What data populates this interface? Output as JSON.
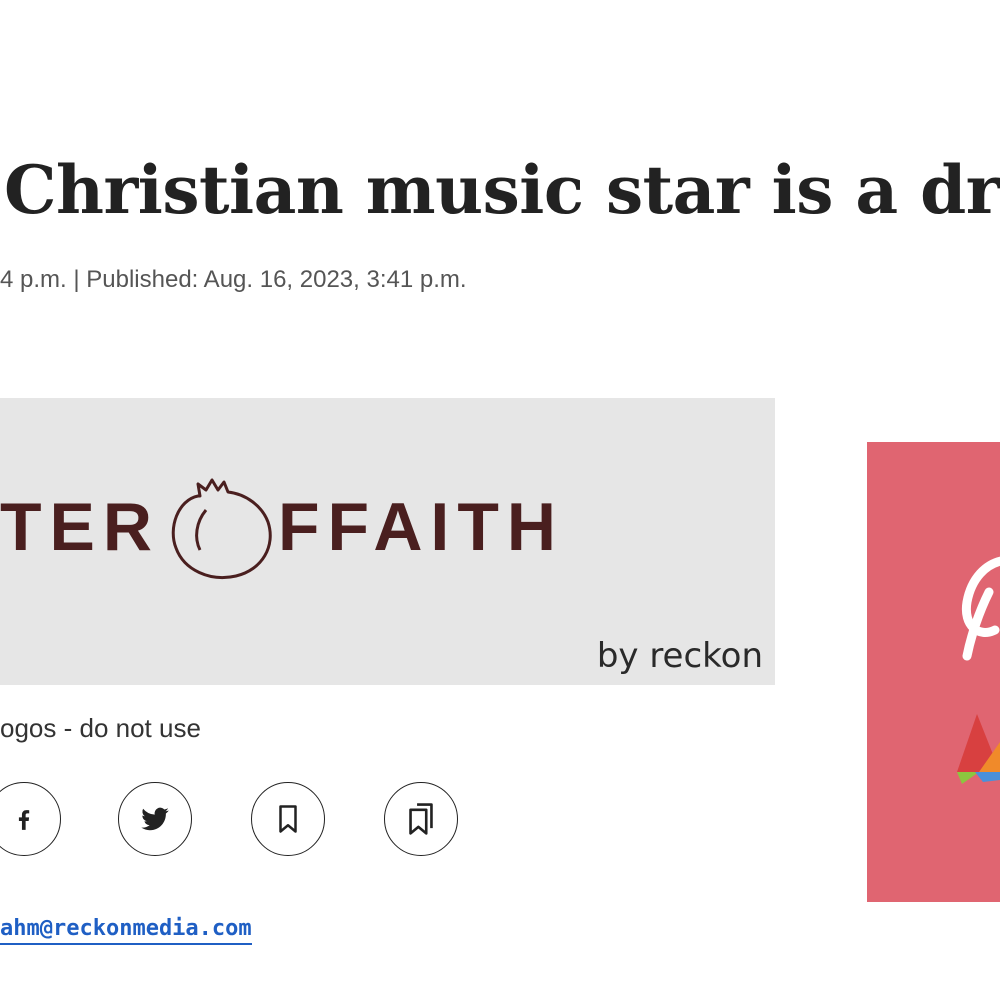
{
  "article": {
    "headline": "Christian music star is a dra",
    "dateline": "4 p.m. | Published: Aug. 16, 2023, 3:41 p.m."
  },
  "hero": {
    "logo_text_left": "TER",
    "logo_text_right": "FFAITH",
    "logo_lettering": "MATTER OF FAITH",
    "byline": "by reckon",
    "background_color": "#e6e6e6",
    "logo_color": "#4a1f1f"
  },
  "caption": {
    "text": "ogos - do not use"
  },
  "share": {
    "buttons": [
      {
        "icon": "facebook-icon"
      },
      {
        "icon": "twitter-icon"
      },
      {
        "icon": "bookmark-icon"
      },
      {
        "icon": "saved-bookmarks-icon"
      }
    ]
  },
  "author": {
    "email": "ahm@reckonmedia.com"
  },
  "ad": {
    "background_color": "#e06571"
  },
  "colors": {
    "headline": "#222222",
    "link": "#1f5fc4"
  }
}
